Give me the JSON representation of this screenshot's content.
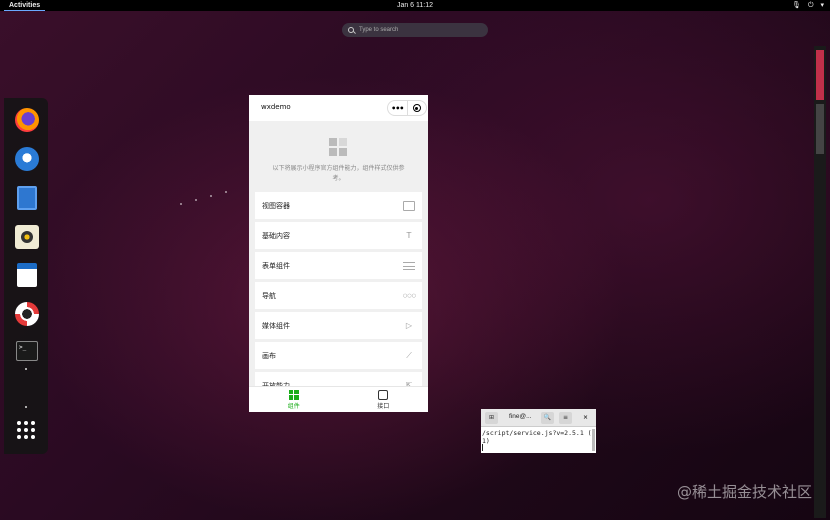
{
  "topbar": {
    "activities": "Activities",
    "clock": "Jan 6  11:12",
    "tray": [
      "🎙",
      "⏻",
      "▾"
    ]
  },
  "search": {
    "placeholder": "Type to search"
  },
  "dock": {
    "apps": [
      "firefox",
      "thunderbird",
      "files",
      "rhythmbox",
      "libreoffice-writer",
      "help",
      "terminal"
    ],
    "terminal_glyph": ">_"
  },
  "phone": {
    "title": "wxdemo",
    "capsule_more": "•••",
    "intro": "以下将展示小程序官方组件能力，组件样式仅供参考。",
    "menu": [
      {
        "label": "视图容器",
        "icon": "view-icon"
      },
      {
        "label": "基础内容",
        "icon": "text-icon",
        "glyph": "T"
      },
      {
        "label": "表单组件",
        "icon": "form-icon"
      },
      {
        "label": "导航",
        "icon": "more-icon",
        "glyph": "○○○"
      },
      {
        "label": "媒体组件",
        "icon": "play-icon",
        "glyph": "▷"
      },
      {
        "label": "画布",
        "icon": "line-icon",
        "glyph": "⟋"
      },
      {
        "label": "开放能力",
        "icon": "share-icon",
        "glyph": "⇱"
      }
    ],
    "tabs": [
      {
        "label": "组件",
        "active": true
      },
      {
        "label": "接口",
        "active": false
      }
    ]
  },
  "terminal": {
    "title": "fine@...",
    "buttons": {
      "new": "⊞",
      "search": "🔍",
      "menu": "≡",
      "close": "×"
    },
    "lines": [
      "/script/service.js?v=2.5.1 (",
      "1)"
    ]
  },
  "watermark": "@稀土掘金技术社区",
  "colors": {
    "accent_green": "#1aad19",
    "scroll_accent": "#c0304a"
  }
}
